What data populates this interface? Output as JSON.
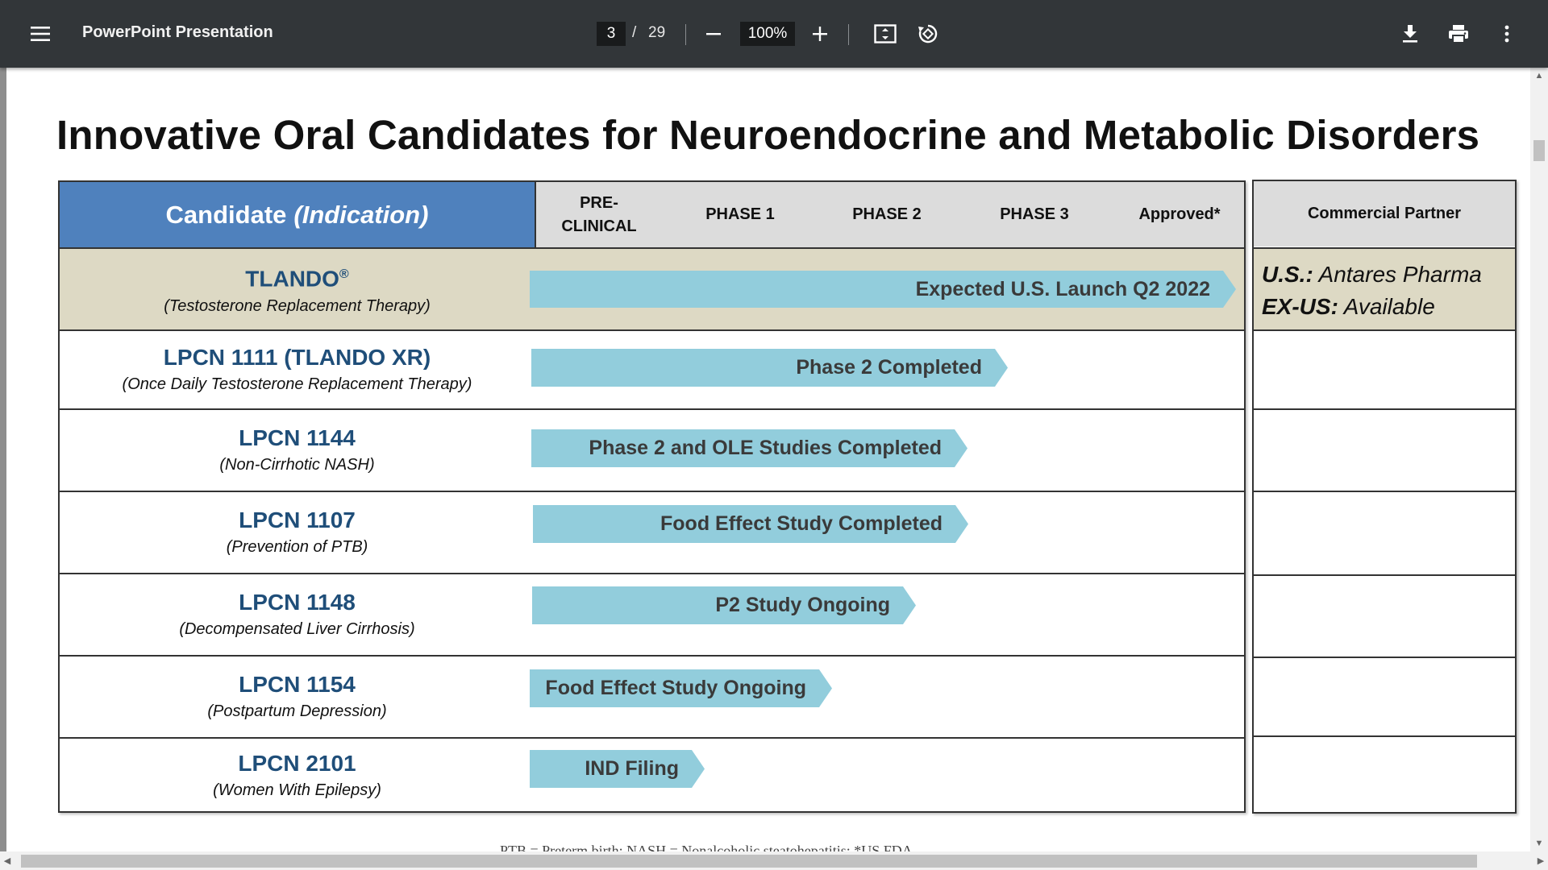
{
  "toolbar": {
    "title": "PowerPoint Presentation",
    "page_current": "3",
    "page_separator": "/",
    "page_total": "29",
    "zoom": "100%",
    "icons": [
      "menu-icon",
      "zoom-out-icon",
      "zoom-in-icon",
      "fit-page-icon",
      "rotate-icon",
      "download-icon",
      "print-icon",
      "more-vert-icon"
    ]
  },
  "slide": {
    "title": "Innovative Oral Candidates for Neuroendocrine and Metabolic Disorders",
    "header": {
      "candidate": "Candidate",
      "indication": "(Indication)",
      "phases": [
        "PRE-\nCLINICAL",
        "PHASE 1",
        "PHASE 2",
        "PHASE 3",
        "Approved*"
      ],
      "partner": "Commercial Partner"
    },
    "rows": [
      {
        "name": "TLANDO",
        "mark": "®",
        "indication": "(Testosterone Replacement Therapy)",
        "status": "Expected U.S. Launch Q2 2022",
        "progress_phase": "Approved*"
      },
      {
        "name": "LPCN 1111 (TLANDO XR)",
        "indication": "(Once Daily Testosterone Replacement Therapy)",
        "status": "Phase 2 Completed",
        "progress_phase": "PHASE 2"
      },
      {
        "name": "LPCN 1144",
        "indication": "(Non-Cirrhotic NASH)",
        "status": "Phase 2 and OLE Studies Completed",
        "progress_phase": "PHASE 2"
      },
      {
        "name": "LPCN 1107",
        "indication": "(Prevention of PTB)",
        "status": "Food Effect Study Completed",
        "progress_phase": "PHASE 2"
      },
      {
        "name": "LPCN 1148",
        "indication": "(Decompensated Liver Cirrhosis)",
        "status": "P2 Study Ongoing",
        "progress_phase": "PHASE 2"
      },
      {
        "name": "LPCN 1154",
        "indication": "(Postpartum Depression)",
        "status": "Food Effect Study Ongoing",
        "progress_phase": "PHASE 1"
      },
      {
        "name": "LPCN 2101",
        "indication": "(Women With Epilepsy)",
        "status": "IND Filing",
        "progress_phase": "PRE-CLINICAL"
      }
    ],
    "partner": {
      "us_label": "U.S.:",
      "us_value": "Antares Pharma",
      "exus_label": "EX-US:",
      "exus_value": "Available"
    },
    "footnote": "PTB = Preterm birth; NASH = Nonalcoholic steatohepatitis; *US FDA"
  },
  "colors": {
    "toolbar_bg": "#323639",
    "header_blue": "#4f81bd",
    "header_gray": "#dcdcdc",
    "highlight_row": "#ddd9c4",
    "arrow_fill": "#92cddc",
    "candidate_text": "#1f4e79"
  }
}
